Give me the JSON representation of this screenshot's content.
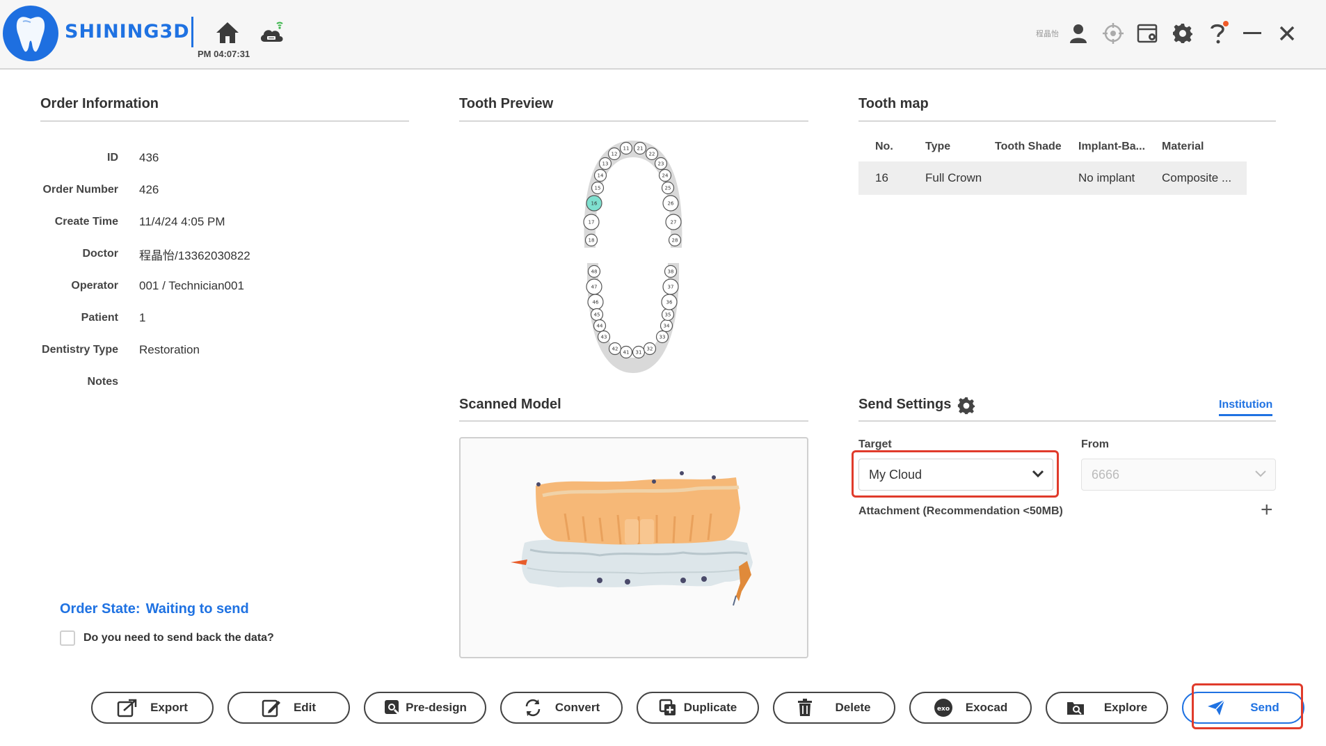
{
  "header": {
    "brand": "SHINING3D",
    "clock": "PM 04:07:31",
    "user_name": "程晶怡"
  },
  "order_info": {
    "title": "Order Information",
    "rows": [
      {
        "label": "ID",
        "value": "436"
      },
      {
        "label": "Order Number",
        "value": "426"
      },
      {
        "label": "Create Time",
        "value": "11/4/24 4:05 PM"
      },
      {
        "label": "Doctor",
        "value": "程晶怡/13362030822"
      },
      {
        "label": "Operator",
        "value": "001 / Technician001"
      },
      {
        "label": "Patient",
        "value": "1"
      },
      {
        "label": "Dentistry Type",
        "value": "Restoration"
      },
      {
        "label": "Notes",
        "value": ""
      }
    ],
    "state_label": "Order State:",
    "state_value": "Waiting to send",
    "sendback_label": "Do you need to send back the data?",
    "sendback_checked": false
  },
  "tooth_preview": {
    "title": "Tooth Preview",
    "selected_tooth": "16",
    "upper_left": [
      "18",
      "17",
      "16",
      "15",
      "14",
      "13",
      "12",
      "11"
    ],
    "upper_right": [
      "21",
      "22",
      "23",
      "24",
      "25",
      "26",
      "27",
      "28"
    ],
    "lower_left": [
      "48",
      "47",
      "46",
      "45",
      "44",
      "43",
      "42",
      "41"
    ],
    "lower_right": [
      "31",
      "32",
      "33",
      "34",
      "35",
      "36",
      "37",
      "38"
    ],
    "selected_color": "#7fe0cf"
  },
  "tooth_map": {
    "title": "Tooth map",
    "columns": [
      "No.",
      "Type",
      "Tooth Shade",
      "Implant-Ba...",
      "Material"
    ],
    "rows": [
      {
        "no": "16",
        "type": "Full Crown",
        "shade": "",
        "implant": "No implant",
        "material": "Composite ..."
      }
    ]
  },
  "scanned_model": {
    "title": "Scanned Model"
  },
  "send_settings": {
    "title": "Send Settings",
    "tab": "Institution",
    "target_label": "Target",
    "target_value": "My Cloud",
    "from_label": "From",
    "from_value": "6666",
    "attachment_label": "Attachment (Recommendation <50MB)",
    "add_icon": "plus-icon"
  },
  "buttons": {
    "export": "Export",
    "edit": "Edit",
    "predesign": "Pre-design",
    "convert": "Convert",
    "duplicate": "Duplicate",
    "delete": "Delete",
    "exocad": "Exocad",
    "explore": "Explore",
    "send": "Send"
  },
  "colors": {
    "accent": "#1f72e2",
    "highlight": "#e03b2b"
  }
}
